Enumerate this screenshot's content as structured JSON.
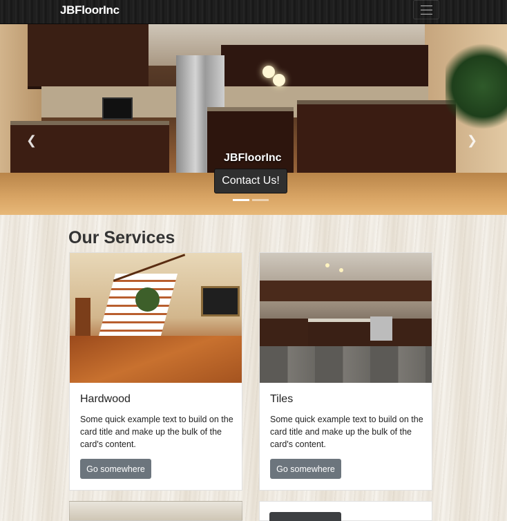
{
  "navbar": {
    "brand": "JBFloorInc",
    "menu_icon": "hamburger-icon"
  },
  "hero": {
    "caption": "JBFloorInc",
    "button_label": "Contact Us!",
    "prev_icon": "chevron-left-icon",
    "next_icon": "chevron-right-icon",
    "active_slide": 1,
    "slide_count": 2
  },
  "services": {
    "title": "Our Services",
    "cards": [
      {
        "title": "Hardwood",
        "text": "Some quick example text to build on the card title and make up the bulk of the card's content.",
        "button": "Go somewhere"
      },
      {
        "title": "Tiles",
        "text": "Some quick example text to build on the card title and make up the bulk of the card's content.",
        "button": "Go somewhere"
      }
    ]
  }
}
